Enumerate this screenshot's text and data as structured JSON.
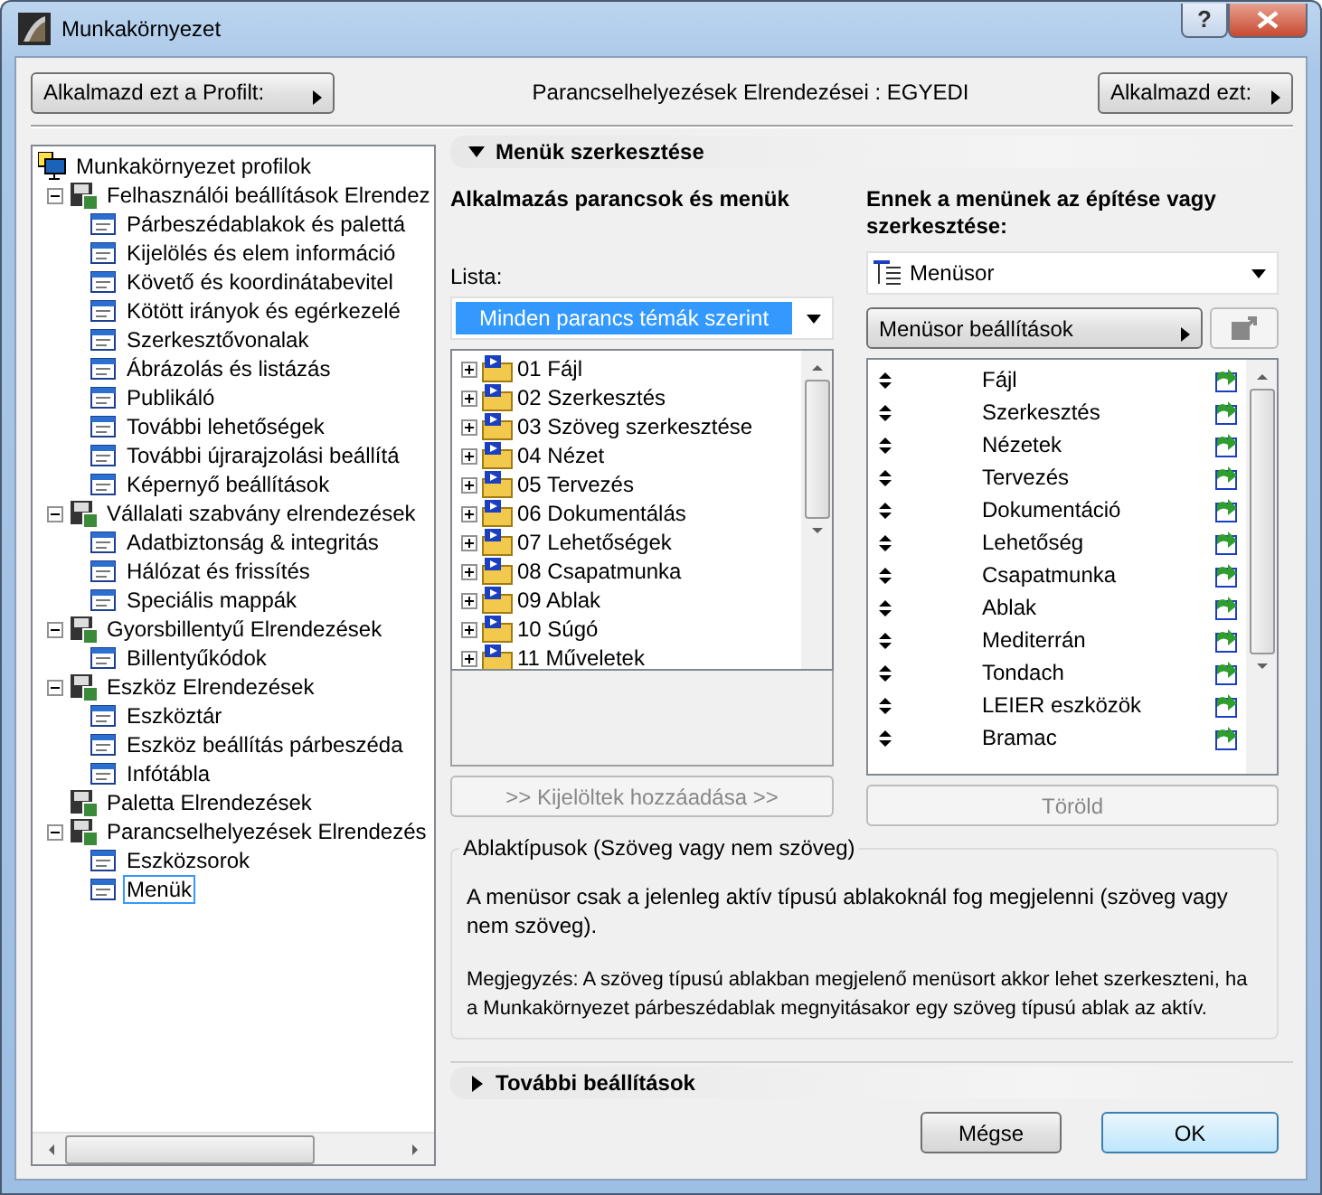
{
  "window": {
    "title": "Munkakörnyezet",
    "help": "?"
  },
  "toolbar": {
    "apply_profile_button": {
      "label": "Alkalmazd ezt a Profilt:"
    },
    "status": "Parancselhelyezések Elrendezései : EGYEDI",
    "apply_button": {
      "label": "Alkalmazd ezt:"
    }
  },
  "profile_tree": {
    "root": {
      "label": "Munkakörnyezet profilok",
      "selected": false,
      "children": [
        {
          "label": "Felhasználói beállítások Elrendez",
          "expanded": true,
          "selected": false,
          "children": [
            {
              "label": "Párbeszédablakok és palettá",
              "selected": false
            },
            {
              "label": "Kijelölés és elem információ",
              "selected": false
            },
            {
              "label": "Követő és koordinátabevitel",
              "selected": false
            },
            {
              "label": "Kötött irányok és egérkezelé",
              "selected": false
            },
            {
              "label": "Szerkesztővonalak",
              "selected": false
            },
            {
              "label": "Ábrázolás és listázás",
              "selected": false
            },
            {
              "label": "Publikáló",
              "selected": false
            },
            {
              "label": "További lehetőségek",
              "selected": false
            },
            {
              "label": "További újrarajzolási beállítá",
              "selected": false
            },
            {
              "label": "Képernyő beállítások",
              "selected": false
            }
          ]
        },
        {
          "label": "Vállalati szabvány elrendezések",
          "expanded": true,
          "selected": false,
          "children": [
            {
              "label": "Adatbiztonság & integritás",
              "selected": false
            },
            {
              "label": "Hálózat és frissítés",
              "selected": false
            },
            {
              "label": "Speciális mappák",
              "selected": false
            }
          ]
        },
        {
          "label": "Gyorsbillentyű Elrendezések",
          "expanded": true,
          "selected": false,
          "children": [
            {
              "label": "Billentyűkódok",
              "selected": false
            }
          ]
        },
        {
          "label": "Eszköz Elrendezések",
          "expanded": true,
          "selected": false,
          "children": [
            {
              "label": "Eszköztár",
              "selected": false
            },
            {
              "label": "Eszköz beállítás párbeszéda",
              "selected": false
            },
            {
              "label": "Infótábla",
              "selected": false
            }
          ]
        },
        {
          "label": "Paletta Elrendezések",
          "selected": false
        },
        {
          "label": "Parancselhelyezések Elrendezés",
          "expanded": true,
          "selected": false,
          "children": [
            {
              "label": "Eszközsorok",
              "selected": false
            },
            {
              "label": "Menük",
              "selected": true
            }
          ]
        }
      ]
    }
  },
  "edit_section": {
    "title": "Menük szerkesztése",
    "expanded": true,
    "commands": {
      "heading": "Alkalmazás parancsok és menük",
      "list_label": "Lista:",
      "dropdown": {
        "value": "Minden parancs témák szerint"
      },
      "items": [
        {
          "label": "01 Fájl",
          "expanded": false
        },
        {
          "label": "02 Szerkesztés",
          "expanded": false
        },
        {
          "label": "03 Szöveg szerkesztése",
          "expanded": false
        },
        {
          "label": "04 Nézet",
          "expanded": false
        },
        {
          "label": "05 Tervezés",
          "expanded": false
        },
        {
          "label": "06 Dokumentálás",
          "expanded": false
        },
        {
          "label": "07 Lehetőségek",
          "expanded": false
        },
        {
          "label": "08 Csapatmunka",
          "expanded": false
        },
        {
          "label": "09 Ablak",
          "expanded": false
        },
        {
          "label": "10 Súgó",
          "expanded": false
        },
        {
          "label": "11 Műveletek",
          "expanded": false
        }
      ],
      "add_button": {
        "label": ">> Kijelöltek hozzáadása >>",
        "disabled": true
      }
    },
    "menu": {
      "heading": "Ennek a menünek az építése vagy szerkesztése:",
      "dropdown": {
        "value": "Menüsor"
      },
      "settings_button": {
        "label": "Menüsor beállítások"
      },
      "export_button": {
        "disabled": true
      },
      "items": [
        "Fájl",
        "Szerkesztés",
        "Nézetek",
        "Tervezés",
        "Dokumentáció",
        "Lehetőség",
        "Csapatmunka",
        "Ablak",
        "Mediterrán",
        "Tondach",
        "LEIER eszközök",
        "Bramac"
      ],
      "delete_button": {
        "label": "Töröld",
        "disabled": true
      }
    },
    "window_types": {
      "legend": "Ablaktípusok (Szöveg vagy nem szöveg)",
      "text": "A menüsor csak a jelenleg aktív típusú ablakoknál fog megjelenni (szöveg vagy nem szöveg).",
      "note": "Megjegyzés: A szöveg típusú ablakban megjelenő menüsort akkor lehet szerkeszteni, ha a Munkakörnyezet párbeszédablak megnyitásakor egy szöveg típusú ablak az aktív."
    }
  },
  "more_section": {
    "title": "További beállítások",
    "expanded": false
  },
  "buttons": [
    {
      "label": "Mégse",
      "default": false
    },
    {
      "label": "OK",
      "default": true
    }
  ]
}
